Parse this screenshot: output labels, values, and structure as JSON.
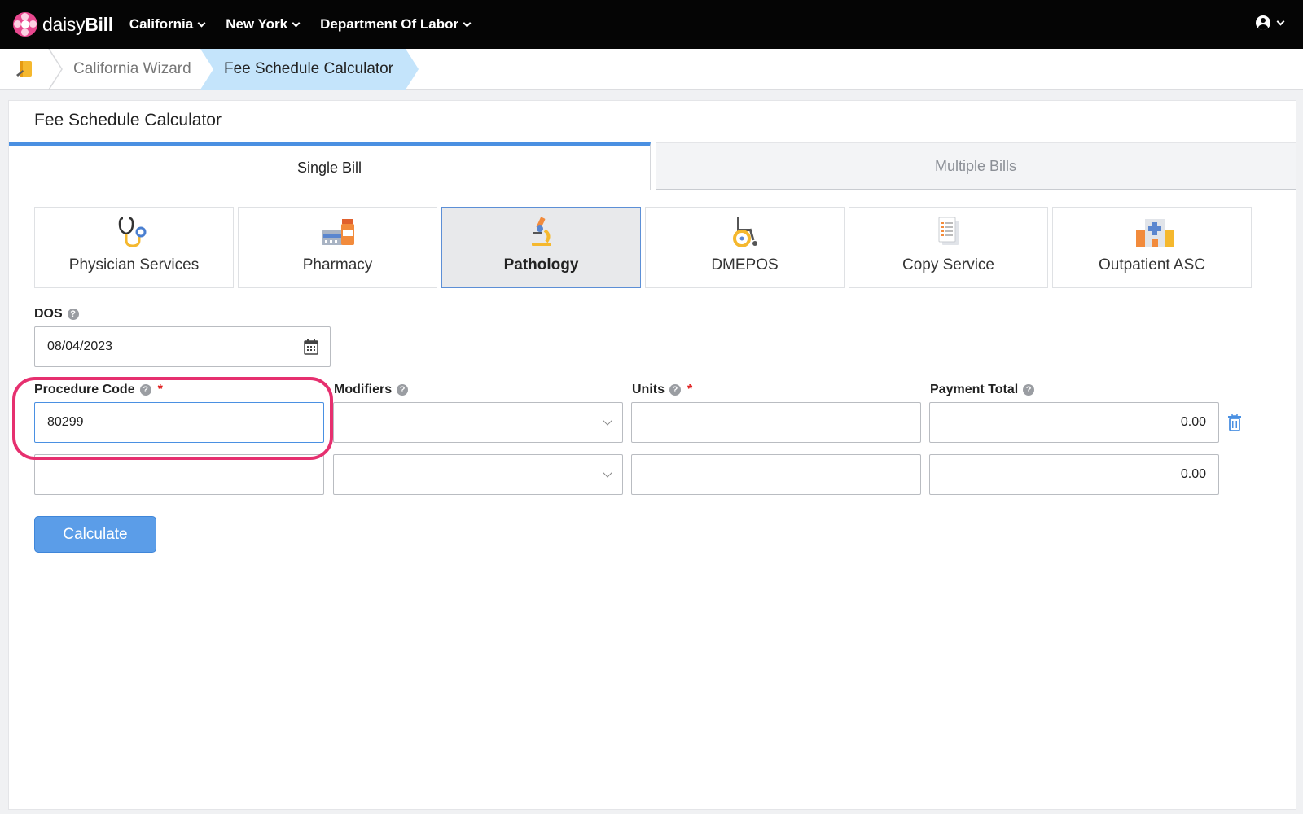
{
  "brand": {
    "name_light": "daisy",
    "name_bold": "Bill",
    "color": "#e8488f"
  },
  "nav": {
    "items": [
      {
        "label": "California"
      },
      {
        "label": "New York"
      },
      {
        "label": "Department Of Labor"
      }
    ]
  },
  "breadcrumb": {
    "items": [
      {
        "label": "California Wizard"
      },
      {
        "label": "Fee Schedule Calculator"
      }
    ]
  },
  "panel": {
    "title": "Fee Schedule Calculator"
  },
  "tabs": [
    {
      "label": "Single Bill",
      "active": true
    },
    {
      "label": "Multiple Bills",
      "active": false
    }
  ],
  "service_types": [
    {
      "label": "Physician Services",
      "icon": "stethoscope-icon",
      "selected": false
    },
    {
      "label": "Pharmacy",
      "icon": "pharmacy-icon",
      "selected": false
    },
    {
      "label": "Pathology",
      "icon": "microscope-icon",
      "selected": true
    },
    {
      "label": "DMEPOS",
      "icon": "wheelchair-icon",
      "selected": false
    },
    {
      "label": "Copy Service",
      "icon": "document-icon",
      "selected": false
    },
    {
      "label": "Outpatient ASC",
      "icon": "hospital-icon",
      "selected": false
    }
  ],
  "form": {
    "dos_label": "DOS",
    "dos_value": "08/04/2023",
    "help_glyph": "?",
    "required_mark": "*",
    "columns": {
      "procedure_code": "Procedure Code",
      "modifiers": "Modifiers",
      "units": "Units",
      "payment_total": "Payment Total"
    },
    "rows": [
      {
        "procedure_code": "80299",
        "modifiers": "",
        "units": "",
        "payment_total": "0.00"
      },
      {
        "procedure_code": "",
        "modifiers": "",
        "units": "",
        "payment_total": "0.00"
      }
    ],
    "calculate_label": "Calculate"
  },
  "colors": {
    "accent": "#4a90e2",
    "highlight": "#e6306f",
    "breadcrumb_active": "#c4e4fb"
  }
}
